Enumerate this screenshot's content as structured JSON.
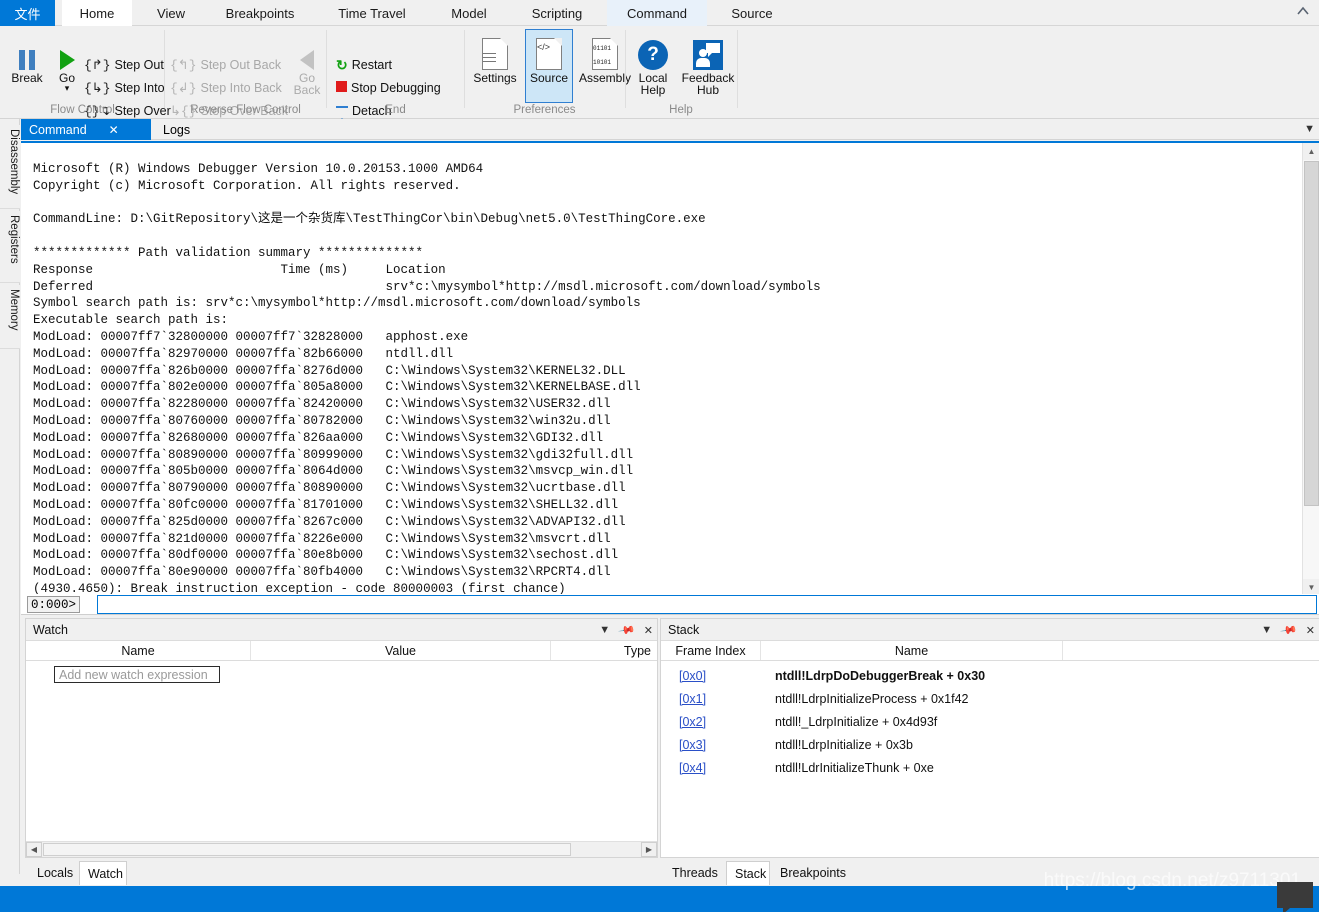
{
  "ribbon": {
    "file_tab": "文件",
    "tabs": [
      {
        "label": "Home",
        "state": "active"
      },
      {
        "label": "View",
        "state": "normal"
      },
      {
        "label": "Breakpoints",
        "state": "normal"
      },
      {
        "label": "Time Travel",
        "state": "normal"
      },
      {
        "label": "Model",
        "state": "normal"
      },
      {
        "label": "Scripting",
        "state": "normal"
      },
      {
        "label": "Command",
        "state": "highlight"
      },
      {
        "label": "Source",
        "state": "normal"
      }
    ],
    "collapse_icon": "chevron-up-icon",
    "groups": {
      "flow_control": {
        "label": "Flow Control",
        "break": "Break",
        "go": "Go",
        "step_out": "Step Out",
        "step_into": "Step Into",
        "step_over": "Step Over"
      },
      "reverse_flow_control": {
        "label": "Reverse Flow Control",
        "step_out_back": "Step Out Back",
        "step_into_back": "Step Into Back",
        "step_over_back": "Step Over Back",
        "go_back": "Go Back"
      },
      "end": {
        "label": "End",
        "restart": "Restart",
        "stop_debugging": "Stop Debugging",
        "detach": "Detach"
      },
      "preferences": {
        "label": "Preferences",
        "settings": "Settings",
        "source": "Source",
        "assembly": "Assembly",
        "assembly_bits": "01101\n10101"
      },
      "help": {
        "label": "Help",
        "local_help": "Local Help",
        "feedback_hub": "Feedback Hub"
      }
    }
  },
  "left_sidebar": {
    "items": [
      {
        "label": "Disassembly"
      },
      {
        "label": "Registers"
      },
      {
        "label": "Memory"
      }
    ]
  },
  "doc_tabs": {
    "items": [
      {
        "label": "Command",
        "active": true,
        "close_icon": "close-icon"
      },
      {
        "label": "Logs",
        "active": false
      }
    ],
    "overflow_icon": "chevron-down-icon"
  },
  "command_output": {
    "text": "Microsoft (R) Windows Debugger Version 10.0.20153.1000 AMD64\nCopyright (c) Microsoft Corporation. All rights reserved.\n\nCommandLine: D:\\GitRepository\\这是一个杂货库\\TestThingCor\\bin\\Debug\\net5.0\\TestThingCore.exe\n\n************* Path validation summary **************\nResponse                         Time (ms)     Location\nDeferred                                       srv*c:\\mysymbol*http://msdl.microsoft.com/download/symbols\nSymbol search path is: srv*c:\\mysymbol*http://msdl.microsoft.com/download/symbols\nExecutable search path is:\nModLoad: 00007ff7`32800000 00007ff7`32828000   apphost.exe\nModLoad: 00007ffa`82970000 00007ffa`82b66000   ntdll.dll\nModLoad: 00007ffa`826b0000 00007ffa`8276d000   C:\\Windows\\System32\\KERNEL32.DLL\nModLoad: 00007ffa`802e0000 00007ffa`805a8000   C:\\Windows\\System32\\KERNELBASE.dll\nModLoad: 00007ffa`82280000 00007ffa`82420000   C:\\Windows\\System32\\USER32.dll\nModLoad: 00007ffa`80760000 00007ffa`80782000   C:\\Windows\\System32\\win32u.dll\nModLoad: 00007ffa`82680000 00007ffa`826aa000   C:\\Windows\\System32\\GDI32.dll\nModLoad: 00007ffa`80890000 00007ffa`80999000   C:\\Windows\\System32\\gdi32full.dll\nModLoad: 00007ffa`805b0000 00007ffa`8064d000   C:\\Windows\\System32\\msvcp_win.dll\nModLoad: 00007ffa`80790000 00007ffa`80890000   C:\\Windows\\System32\\ucrtbase.dll\nModLoad: 00007ffa`80fc0000 00007ffa`81701000   C:\\Windows\\System32\\SHELL32.dll\nModLoad: 00007ffa`825d0000 00007ffa`8267c000   C:\\Windows\\System32\\ADVAPI32.dll\nModLoad: 00007ffa`821d0000 00007ffa`8226e000   C:\\Windows\\System32\\msvcrt.dll\nModLoad: 00007ffa`80df0000 00007ffa`80e8b000   C:\\Windows\\System32\\sechost.dll\nModLoad: 00007ffa`80e90000 00007ffa`80fb4000   C:\\Windows\\System32\\RPCRT4.dll\n(4930.4650): Break instruction exception - code 80000003 (first chance)",
    "scrollbar": {
      "up_icon": "caret-up-icon",
      "down_icon": "caret-down-icon"
    }
  },
  "prompt": {
    "label": "0:000>",
    "value": "",
    "placeholder": ""
  },
  "watch_pane": {
    "title": "Watch",
    "tools": {
      "menu_icon": "caret-down-icon",
      "pin_icon": "pin-icon",
      "close_icon": "close-icon"
    },
    "columns": [
      "Name",
      "Value",
      "Type"
    ],
    "add_row_placeholder": "Add new watch expression",
    "hscroll": {
      "left_icon": "caret-left-icon",
      "right_icon": "caret-right-icon"
    }
  },
  "stack_pane": {
    "title": "Stack",
    "tools": {
      "menu_icon": "caret-down-icon",
      "pin_icon": "pin-icon",
      "close_icon": "close-icon"
    },
    "columns": [
      "Frame Index",
      "Name"
    ],
    "rows": [
      {
        "index": "[0x0]",
        "name": "ntdll!LdrpDoDebuggerBreak + 0x30",
        "selected": true
      },
      {
        "index": "[0x1]",
        "name": "ntdll!LdrpInitializeProcess + 0x1f42",
        "selected": false
      },
      {
        "index": "[0x2]",
        "name": "ntdll!_LdrpInitialize + 0x4d93f",
        "selected": false
      },
      {
        "index": "[0x3]",
        "name": "ntdll!LdrpInitialize + 0x3b",
        "selected": false
      },
      {
        "index": "[0x4]",
        "name": "ntdll!LdrInitializeThunk + 0xe",
        "selected": false
      }
    ]
  },
  "bottom_left_tabs": [
    {
      "label": "Locals",
      "active": false
    },
    {
      "label": "Watch",
      "active": true
    }
  ],
  "bottom_right_tabs": [
    {
      "label": "Threads",
      "active": false
    },
    {
      "label": "Stack",
      "active": true
    },
    {
      "label": "Breakpoints",
      "active": false
    }
  ],
  "watermark": {
    "url": "https://blog.csdn.net/z9711301",
    "badge_icon": "comment-badge-icon"
  },
  "colors": {
    "accent": "#0078d7",
    "ribbon_bg": "#f0f0f0",
    "link": "#2a4fc7",
    "green": "#12a112",
    "red": "#e01b1b"
  }
}
